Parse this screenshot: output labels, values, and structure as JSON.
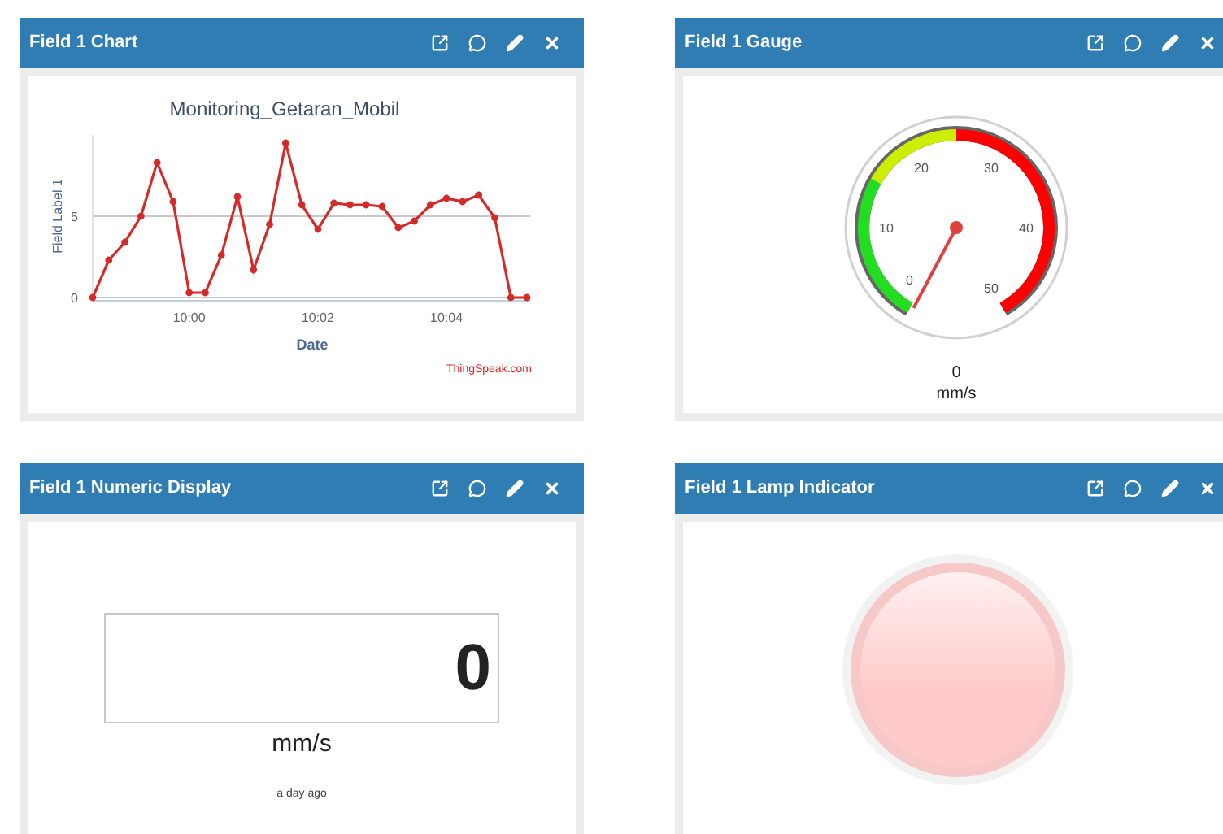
{
  "panels": [
    {
      "kind": "chart",
      "title": "Field 1 Chart",
      "credit": "ThingSpeak.com",
      "chart_data": {
        "type": "line",
        "title": "Monitoring_Getaran_Mobil",
        "xlabel": "Date",
        "ylabel": "Field Label 1",
        "categories": [
          null,
          null,
          null,
          null,
          null,
          null,
          "10:00",
          null,
          null,
          null,
          null,
          null,
          null,
          null,
          "10:02",
          null,
          null,
          null,
          null,
          null,
          null,
          null,
          "10:04",
          null,
          null,
          null,
          null,
          null
        ],
        "series": [
          {
            "color": "#d42a2a",
            "marker": "circle",
            "values": [
              0,
              2.3,
              3.4,
              5,
              8.3,
              5.9,
              0.3,
              0.3,
              2.6,
              6.2,
              1.7,
              4.5,
              9.5,
              5.7,
              4.2,
              5.8,
              5.7,
              5.7,
              5.6,
              4.3,
              4.7,
              5.7,
              6.1,
              5.9,
              6.3,
              4.9,
              0,
              0
            ]
          }
        ],
        "ylim": [
          0,
          10
        ],
        "yticks": [
          0,
          5
        ]
      }
    },
    {
      "kind": "gauge",
      "title": "Field 1 Gauge",
      "ticks": [
        "0",
        "10",
        "20",
        "30",
        "40",
        "50"
      ],
      "value": "0",
      "unit": "mm/s"
    },
    {
      "kind": "numeric",
      "title": "Field 1 Numeric Display",
      "value": "0",
      "unit": "mm/s",
      "updated": "a day ago"
    },
    {
      "kind": "lamp",
      "title": "Field 1 Lamp Indicator",
      "on": false
    }
  ]
}
